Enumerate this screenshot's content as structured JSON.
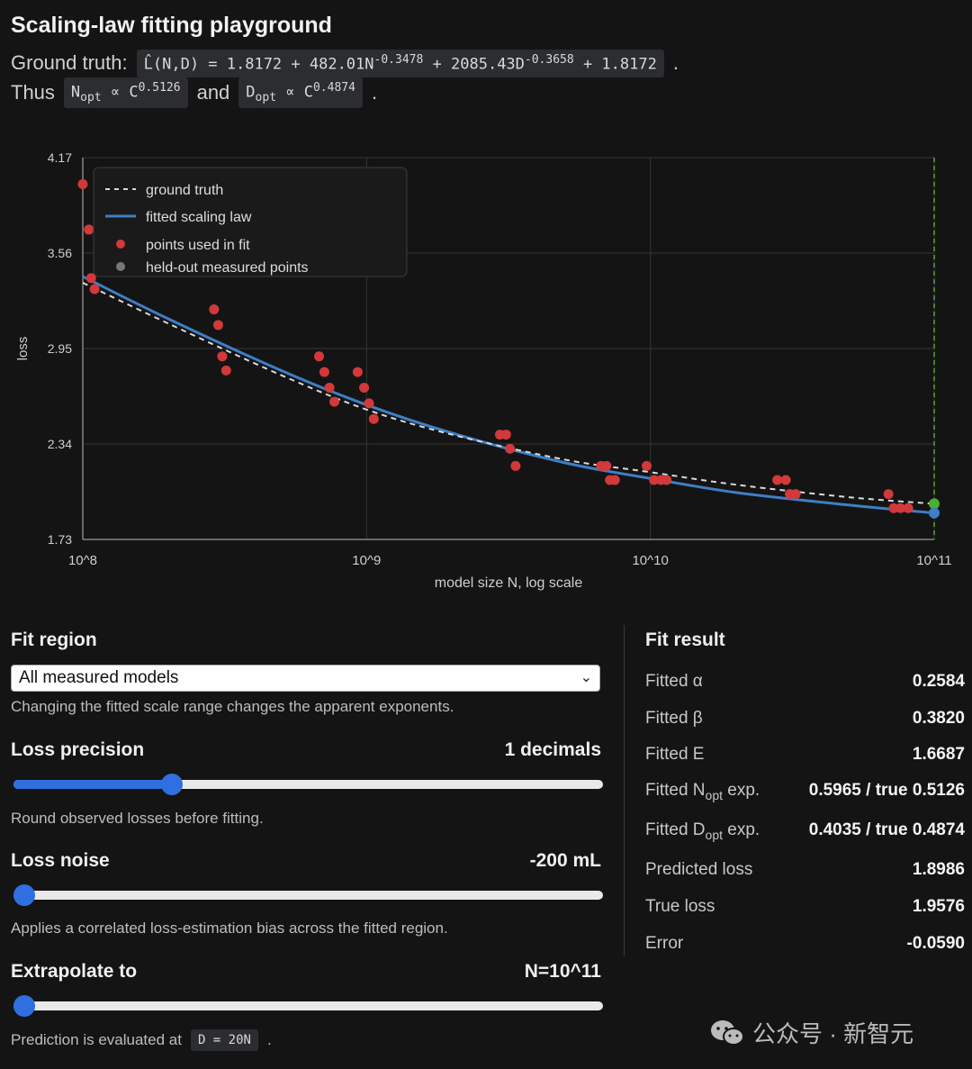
{
  "title": "Scaling-law fitting playground",
  "ground_truth": {
    "label": "Ground truth:",
    "formula_main": "L̂(N,D) = 1.8172 + 482.01N",
    "exp1": "-0.3478",
    "mid": " + 2085.43D",
    "exp2": "-0.3658",
    "tail": " + 1.8172",
    "period": "."
  },
  "thus": {
    "label": "Thus",
    "n_base": "N",
    "n_sub": "opt",
    "n_rel": " ∝ C",
    "n_exp": "0.5126",
    "and": "and",
    "d_base": "D",
    "d_sub": "opt",
    "d_rel": " ∝ C",
    "d_exp": "0.4874",
    "period": "."
  },
  "chart_data": {
    "type": "scatter",
    "xlabel": "model size N, log scale",
    "ylabel": "loss",
    "x_scale": "log",
    "xlim": [
      100000000,
      100000000000
    ],
    "ylim": [
      1.73,
      4.17
    ],
    "x_ticks": [
      "10^8",
      "10^9",
      "10^10",
      "10^11"
    ],
    "y_ticks": [
      "4.17",
      "3.56",
      "2.95",
      "2.34",
      "1.73"
    ],
    "grid": true,
    "legend_position": "top-left",
    "legend": [
      "ground truth",
      "fitted scaling law",
      "points used in fit",
      "held-out measured points"
    ],
    "colors": {
      "ground_truth": "#d9d9d9",
      "fitted": "#3d7fc6",
      "points": "#d2393a",
      "held_out": "#777777",
      "extrap_line": "#4caf2f",
      "true_point": "#4caf2f",
      "pred_point": "#3d7fc6"
    },
    "series": [
      {
        "name": "ground truth",
        "style": "dashed",
        "points": [
          [
            100000000,
            3.37
          ],
          [
            200000000,
            3.11
          ],
          [
            500000000,
            2.78
          ],
          [
            1000000000,
            2.56
          ],
          [
            2000000000,
            2.4
          ],
          [
            5000000000,
            2.24
          ],
          [
            10000000000,
            2.16
          ],
          [
            20000000000,
            2.08
          ],
          [
            50000000000,
            2.0
          ],
          [
            100000000000,
            1.958
          ]
        ]
      },
      {
        "name": "fitted scaling law",
        "style": "solid",
        "points": [
          [
            100000000,
            3.41
          ],
          [
            200000000,
            3.14
          ],
          [
            500000000,
            2.81
          ],
          [
            1000000000,
            2.59
          ],
          [
            2000000000,
            2.41
          ],
          [
            5000000000,
            2.22
          ],
          [
            10000000000,
            2.12
          ],
          [
            20000000000,
            2.03
          ],
          [
            50000000000,
            1.95
          ],
          [
            100000000000,
            1.899
          ]
        ]
      },
      {
        "name": "points used in fit",
        "points": [
          [
            100000000,
            4.0
          ],
          [
            105000000,
            3.71
          ],
          [
            107000000,
            3.4
          ],
          [
            110000000,
            3.33
          ],
          [
            290000000,
            3.2
          ],
          [
            300000000,
            3.1
          ],
          [
            310000000,
            2.9
          ],
          [
            320000000,
            2.81
          ],
          [
            680000000,
            2.9
          ],
          [
            710000000,
            2.8
          ],
          [
            740000000,
            2.7
          ],
          [
            770000000,
            2.61
          ],
          [
            930000000,
            2.8
          ],
          [
            980000000,
            2.7
          ],
          [
            1020000000,
            2.6
          ],
          [
            1060000000,
            2.5
          ],
          [
            2950000000,
            2.4
          ],
          [
            3100000000,
            2.4
          ],
          [
            3200000000,
            2.31
          ],
          [
            3350000000,
            2.2
          ],
          [
            6700000000,
            2.2
          ],
          [
            7000000000,
            2.2
          ],
          [
            7200000000,
            2.11
          ],
          [
            7500000000,
            2.11
          ],
          [
            9700000000,
            2.2
          ],
          [
            10300000000,
            2.11
          ],
          [
            10900000000,
            2.11
          ],
          [
            11400000000,
            2.11
          ],
          [
            28000000000,
            2.11
          ],
          [
            30000000000,
            2.11
          ],
          [
            31000000000,
            2.02
          ],
          [
            32500000000,
            2.02
          ],
          [
            69000000000,
            2.02
          ],
          [
            72000000000,
            1.93
          ],
          [
            76000000000,
            1.93
          ],
          [
            81000000000,
            1.93
          ]
        ]
      }
    ],
    "extrapolation": {
      "x": 100000000000,
      "true_loss": 1.958,
      "predicted_loss": 1.899
    }
  },
  "fit_region": {
    "title": "Fit region",
    "selected": "All measured models",
    "chevron": "⌄",
    "hint": "Changing the fitted scale range changes the apparent exponents."
  },
  "loss_precision": {
    "title": "Loss precision",
    "value_text": "1 decimals",
    "level": 0.26,
    "hint": "Round observed losses before fitting."
  },
  "loss_noise": {
    "title": "Loss noise",
    "value_text": "-200 mL",
    "level": 0.0,
    "hint": "Applies a correlated loss-estimation bias across the fitted region."
  },
  "extrapolate": {
    "title": "Extrapolate to",
    "value_text": "N=10^11",
    "level": 0.0,
    "hint": "Prediction is evaluated at",
    "code": "D = 20N",
    "period": "."
  },
  "fit_result": {
    "title": "Fit result",
    "rows": [
      {
        "label": "Fitted α",
        "value": "0.2584"
      },
      {
        "label": "Fitted β",
        "value": "0.3820"
      },
      {
        "label": "Fitted E",
        "value": "1.6687"
      },
      {
        "label_pre": "Fitted N",
        "label_sub": "opt",
        "label_post": " exp.",
        "value": "0.5965 / true 0.5126"
      },
      {
        "label_pre": "Fitted D",
        "label_sub": "opt",
        "label_post": " exp.",
        "value": "0.4035 / true 0.4874"
      },
      {
        "label": "Predicted loss",
        "value": "1.8986"
      },
      {
        "label": "True loss",
        "value": "1.9576"
      },
      {
        "label": "Error",
        "value": "-0.0590"
      }
    ]
  },
  "watermark": "公众号 · 新智元"
}
